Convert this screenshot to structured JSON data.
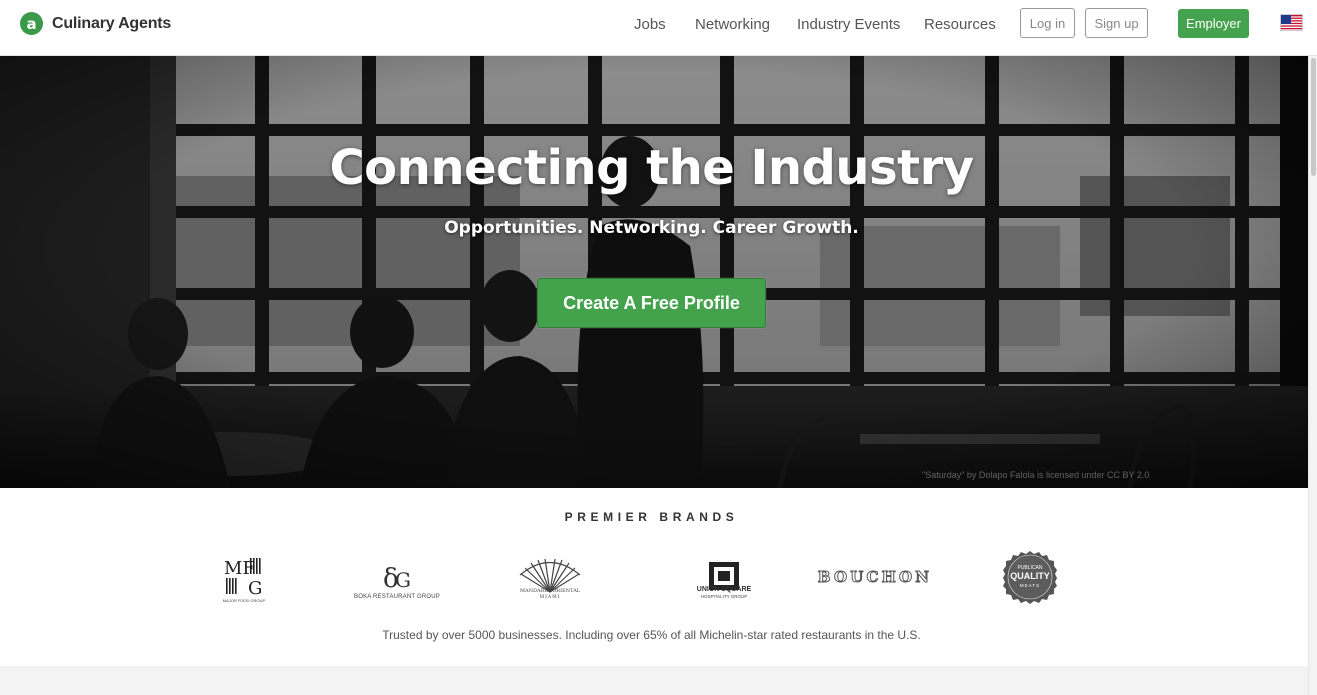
{
  "header": {
    "brand_name": "Culinary Agents",
    "logo_icon": "a",
    "nav": [
      "Jobs",
      "Networking",
      "Industry Events",
      "Resources"
    ],
    "login_label": "Log in",
    "signup_label": "Sign up",
    "employer_label": "Employer",
    "flag_icon": "us-flag-icon"
  },
  "hero": {
    "title": "Connecting the Industry",
    "subtitle": "Opportunities. Networking. Career Growth.",
    "cta_label": "Create A Free Profile",
    "photo_credit": "\"Saturday\" by Dolapo Falola is licensed under CC BY 2.0"
  },
  "brands": {
    "heading": "PREMIER BRANDS",
    "logos": [
      {
        "name": "Major Food Group",
        "caption": "MAJOR FOOD GROUP"
      },
      {
        "name": "Boka Restaurant Group",
        "caption": "BOKA RESTAURANT GROUP"
      },
      {
        "name": "Mandarin Oriental Miami",
        "caption": "MANDARIN ORIENTAL",
        "subcaption": "MIAMI"
      },
      {
        "name": "Union Square Hospitality Group",
        "caption": "UNION SQUARE",
        "subcaption": "HOSPITALITY GROUP"
      },
      {
        "name": "Bouchon",
        "caption": "BOUCHON"
      },
      {
        "name": "Publican Quality Meats",
        "caption": "PUBLICAN",
        "subcaption": "QUALITY",
        "tertiary": "MEATS"
      }
    ],
    "trusted_text": "Trusted by over 5000 businesses. Including over 65% of all Michelin-star rated restaurants in the U.S."
  },
  "colors": {
    "accent": "#45a34f",
    "logo_green": "#3a9a4a"
  }
}
